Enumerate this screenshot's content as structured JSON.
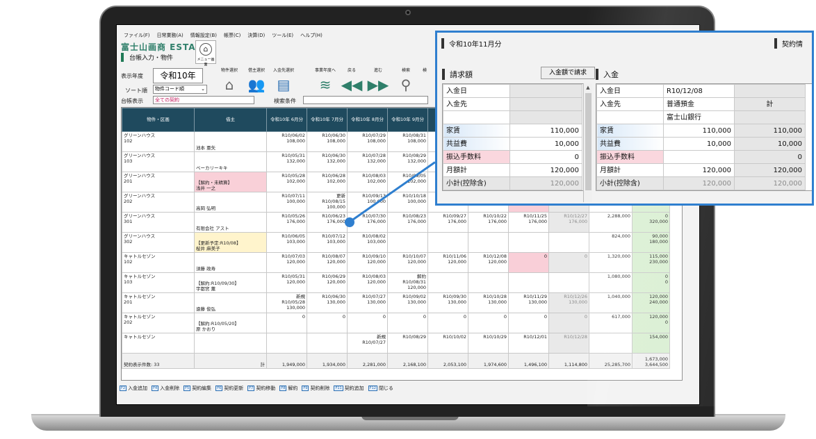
{
  "menubar": {
    "items": [
      "ファイル(F)",
      "日常業務(A)",
      "情報設定(B)",
      "帳票(C)",
      "決算(D)",
      "ツール(E)",
      "ヘルプ(H)"
    ]
  },
  "app": {
    "logo": "富士山画商 ESTA",
    "subtitle": "台帳入力・物件",
    "menu_btn": "メニュー画面"
  },
  "filters": {
    "year_label": "表示年度",
    "year_value": "令和10年",
    "sort_label": "ソート順",
    "sort_value": "物件コード順",
    "ledger_label": "台帳表示",
    "ledger_value": "全ての契約",
    "search_label": "検索条件"
  },
  "toolbar": {
    "prop_select": "物件選択",
    "owner_select": "借主選択",
    "deposit_select": "入金先選択",
    "year_prev": "事業年度へ",
    "back": "戻る",
    "forward": "進む",
    "search": "検索",
    "settings": "検"
  },
  "grid": {
    "headers": [
      "物件・区画",
      "借主",
      "令和10年\n6月分",
      "令和10年\n7月分",
      "令和10年\n8月分",
      "令和10年\n9月分",
      "",
      "",
      "",
      "",
      "",
      ""
    ],
    "rows": [
      {
        "prop": "グリーンハウス\n102",
        "owner": "池本 亜矢",
        "owner_style": "",
        "cells": [
          "R10/06/02\n108,000",
          "R10/06/30\n108,000",
          "R10/07/29\n108,000",
          "R10/08/31\n108,000",
          "",
          "",
          "",
          "",
          "",
          ""
        ],
        "styles": [
          "",
          "",
          "",
          "",
          "",
          "",
          "",
          "",
          "",
          ""
        ]
      },
      {
        "prop": "グリーンハウス\n103",
        "owner": "ベーカリーキキ",
        "owner_style": "",
        "cells": [
          "R10/05/31\n132,000",
          "R10/06/30\n132,000",
          "R10/07/28\n132,000",
          "R10/08/29\n132,000",
          "",
          "",
          "",
          "",
          "",
          ""
        ],
        "styles": [
          "",
          "",
          "",
          "",
          "",
          "",
          "",
          "",
          "",
          ""
        ]
      },
      {
        "prop": "グリーンハウス\n201",
        "owner": "【解約・未精算】\n浅井 一之",
        "owner_style": "red",
        "cells": [
          "R10/05/28\n102,000",
          "R10/06/28\n102,000",
          "R10/08/03\n102,000",
          "R10/09/05\n102,000",
          "",
          "",
          "",
          "",
          "",
          ""
        ],
        "styles": [
          "",
          "",
          "",
          "",
          "",
          "",
          "",
          "",
          "",
          ""
        ]
      },
      {
        "prop": "グリーンハウス\n202",
        "owner": "高岡 弘明",
        "owner_style": "",
        "cells": [
          "R10/07/11\n100,000",
          "更新\nR10/08/15\n100,000",
          "R10/09/13\n100,000",
          "R10/10/18\n100,000",
          "R10/11/24\n100,000",
          "R10/12/20\n100,000",
          "0",
          "0",
          "1,100,000",
          "85,000\n170,000"
        ],
        "styles": [
          "",
          "",
          "",
          "",
          "",
          "",
          "pink",
          "gray",
          "",
          "green"
        ]
      },
      {
        "prop": "グリーンハウス\n301",
        "owner": "有限会社 アスト",
        "owner_style": "",
        "cells": [
          "R10/05/26\n176,000",
          "R10/06/23\n176,000",
          "R10/07/30\n176,000",
          "R10/08/23\n176,000",
          "R10/09/27\n176,000",
          "R10/10/22\n176,000",
          "R10/11/25\n176,000",
          "R10/12/27\n176,000",
          "2,288,000",
          "0\n320,000"
        ],
        "styles": [
          "",
          "",
          "",
          "",
          "",
          "",
          "",
          "gray",
          "",
          "green"
        ]
      },
      {
        "prop": "グリーンハウス\n302",
        "owner": "【更新予定:R10/08】\n桜井 麻美子",
        "owner_style": "yel",
        "cells": [
          "R10/06/05\n103,000",
          "R10/07/12\n103,000",
          "R10/08/02\n103,000",
          "",
          "",
          "",
          "",
          "",
          "824,000",
          "90,000\n180,000"
        ],
        "styles": [
          "",
          "",
          "",
          "",
          "",
          "",
          "",
          "",
          "",
          "green"
        ]
      },
      {
        "prop": "キャトルセゾン\n102",
        "owner": "須藤 政寿",
        "owner_style": "",
        "cells": [
          "R10/07/03\n120,000",
          "R10/08/07\n120,000",
          "R10/09/10\n120,000",
          "R10/10/07\n120,000",
          "R10/11/06\n120,000",
          "R10/12/08\n120,000",
          "0",
          "0",
          "1,320,000",
          "115,000\n230,000"
        ],
        "styles": [
          "",
          "",
          "",
          "",
          "",
          "",
          "pink",
          "gray",
          "",
          "green"
        ]
      },
      {
        "prop": "キャトルセゾン\n103",
        "owner": "【解約:R10/09/30】\n宇都宮 薫",
        "owner_style": "",
        "cells": [
          "R10/05/31\n120,000",
          "R10/06/29\n120,000",
          "R10/08/03\n120,000",
          "解約\nR10/08/31\n120,000",
          "",
          "",
          "",
          "",
          "1,080,000",
          "0\n0"
        ],
        "styles": [
          "",
          "",
          "",
          "",
          "",
          "",
          "",
          "",
          "",
          "green"
        ]
      },
      {
        "prop": "キャトルセゾン\n201",
        "owner": "遠藤 俊弘",
        "owner_style": "",
        "cells": [
          "新規\nR10/05/28\n130,000",
          "R10/06/30\n130,000",
          "R10/07/27\n130,000",
          "R10/09/02\n130,000",
          "R10/09/30\n130,000",
          "R10/10/28\n130,000",
          "R10/11/29\n130,000",
          "R10/12/26\n130,000",
          "1,040,000",
          "120,000\n240,000"
        ],
        "styles": [
          "",
          "",
          "",
          "",
          "",
          "",
          "",
          "gray",
          "",
          "green"
        ]
      },
      {
        "prop": "キャトルセゾン\n202",
        "owner": "【解約:R10/05/20】\n原 かおり",
        "owner_style": "",
        "cells": [
          "0",
          "0",
          "0",
          "0",
          "0",
          "0",
          "0",
          "0",
          "617,000",
          "120,000\n0"
        ],
        "styles": [
          "",
          "",
          "",
          "",
          "",
          "",
          "",
          "gray",
          "",
          "green"
        ]
      },
      {
        "prop": "キャトルセゾン",
        "owner": "",
        "owner_style": "",
        "cells": [
          "",
          "",
          "新規\nR10/07/27",
          "R10/08/29",
          "R10/10/02",
          "R10/10/29",
          "R10/12/01",
          "R10/12/28",
          "",
          "154,000"
        ],
        "styles": [
          "",
          "",
          "",
          "",
          "",
          "",
          "",
          "gray",
          "",
          "green"
        ]
      }
    ],
    "total": {
      "label": "契約表示件数:",
      "count": "33",
      "sum_label": "計",
      "cells": [
        "1,949,000",
        "1,934,000",
        "2,281,000",
        "2,168,100",
        "2,053,100",
        "1,974,600",
        "1,496,100",
        "1,114,800",
        "25,285,700",
        "1,673,000\n3,644,500"
      ]
    }
  },
  "fkeys": [
    {
      "key": "F2",
      "label": "入金追加"
    },
    {
      "key": "F4",
      "label": "入金削除"
    },
    {
      "key": "F5",
      "label": "契約編集"
    },
    {
      "key": "F6",
      "label": "契約更新"
    },
    {
      "key": "F7",
      "label": "契約移動"
    },
    {
      "key": "F8",
      "label": "解約"
    },
    {
      "key": "F9",
      "label": "契約削除"
    },
    {
      "key": "F11",
      "label": "契約追加"
    },
    {
      "key": "F12",
      "label": "閉じる"
    }
  ],
  "callout": {
    "title": "令和10年11月分",
    "title_right": "契約情",
    "billing": {
      "head": "請求額",
      "button": "入金額で請求",
      "rows": [
        {
          "label": "入金日",
          "value": "",
          "style": "fill"
        },
        {
          "label": "入金先",
          "value": "",
          "style": "fill"
        },
        {
          "label": "",
          "value": "",
          "style": "fill"
        },
        {
          "label": "家賃",
          "value": "110,000",
          "style": "blue"
        },
        {
          "label": "共益費",
          "value": "10,000",
          "style": "blue"
        },
        {
          "label": "振込手数料",
          "value": "0",
          "style": "pink"
        },
        {
          "label": "月額計",
          "value": "120,000",
          "style": ""
        },
        {
          "label": "小計(控除含)",
          "value": "120,000",
          "style": "gray"
        }
      ]
    },
    "deposit": {
      "head": "入金",
      "rows": [
        {
          "label": "入金日",
          "a": "R10/12/08",
          "b": "",
          "style": "fill"
        },
        {
          "label": "入金先",
          "a": "普通預金",
          "b": "計",
          "style": ""
        },
        {
          "label": "",
          "a": "富士山銀行",
          "b": "",
          "style": "fill"
        },
        {
          "label": "家賃",
          "a": "110,000",
          "b": "110,000",
          "style": "blue"
        },
        {
          "label": "共益費",
          "a": "10,000",
          "b": "10,000",
          "style": "blue"
        },
        {
          "label": "振込手数料",
          "a": "",
          "b": "0",
          "style": "pink"
        },
        {
          "label": "月額計",
          "a": "120,000",
          "b": "120,000",
          "style": ""
        },
        {
          "label": "小計(控除含)",
          "a": "120,000",
          "b": "120,000",
          "style": "gray"
        }
      ]
    }
  }
}
